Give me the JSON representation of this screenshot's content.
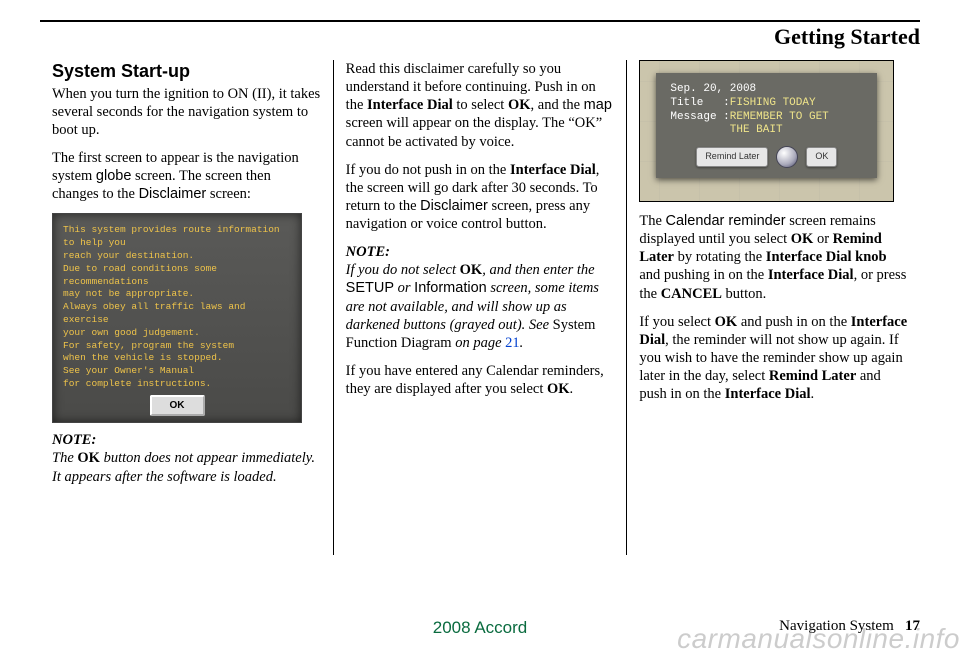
{
  "header": {
    "title": "Getting Started"
  },
  "col1": {
    "section_title": "System Start-up",
    "p1a": "When you turn the ignition to ON (II), it takes several seconds for the navigation system to boot up.",
    "p2_pre": "The first screen to appear is the navigation system ",
    "p2_globe": "globe",
    "p2_mid": " screen. The screen then changes to the ",
    "p2_disc": "Disclaimer",
    "p2_post": " screen:",
    "screen": {
      "l1": "This system provides route information to help you",
      "l2": "reach your destination.",
      "l3": "Due to road conditions some recommendations",
      "l4": "may not be appropriate.",
      "l5": "Always obey all traffic laws and exercise",
      "l6": "your own good judgement.",
      "l7": "For safety, program the system",
      "l8": "when the vehicle is stopped.",
      "l9": "See your Owner's Manual",
      "l10": "for complete instructions.",
      "ok": "OK"
    },
    "note_label": "NOTE:",
    "note_pre": "The ",
    "note_ok": "OK",
    "note_post": " button does not appear immediately. It appears after the software is loaded."
  },
  "col2": {
    "p1_pre": "Read this disclaimer carefully so you understand it before continuing. Push in on the ",
    "p1_id": "Interface Dial",
    "p1_mid1": " to select ",
    "p1_ok": "OK",
    "p1_mid2": ", and the ",
    "p1_map": "map",
    "p1_post": " screen will appear on the display. The “OK” cannot be activated by voice.",
    "p2_pre": "If you do not push in on the ",
    "p2_id": "Interface Dial",
    "p2_mid1": ", the screen will go dark after 30 seconds. To return to the ",
    "p2_disc": "Disclaimer",
    "p2_post": " screen, press any navigation or voice control button.",
    "note_label": "NOTE:",
    "n_pre": "If you do not select ",
    "n_ok": "OK",
    "n_mid1": ", and then enter the ",
    "n_setup": "SETUP",
    "n_or": " or ",
    "n_info": "Information",
    "n_mid2": " screen, some items are not available, and will show up as darkened buttons (grayed out). See ",
    "n_sfd": "System Function Diagram",
    "n_on": " on page ",
    "n_page": "21",
    "n_period": ".",
    "p3_pre": "If you have entered any Calendar reminders, they are displayed after you select ",
    "p3_ok": "OK",
    "p3_post": "."
  },
  "col3": {
    "popup": {
      "date": "Sep. 20, 2008",
      "title_label": "Title   :",
      "title_value": "FISHING TODAY",
      "msg_label": "Message :",
      "msg_value1": "REMEMBER TO GET",
      "msg_value2": "THE BAIT",
      "remind": "Remind Later",
      "ok": "OK"
    },
    "p1_pre": "The ",
    "p1_cal": "Calendar reminder",
    "p1_mid1": " screen remains displayed until you select ",
    "p1_ok": "OK",
    "p1_or": " or ",
    "p1_rl": "Remind Later",
    "p1_mid2": " by rotating the ",
    "p1_idk": "Interface Dial knob",
    "p1_mid3": " and pushing in on the ",
    "p1_id": "Interface Dial",
    "p1_mid4": ", or press the ",
    "p1_cancel": "CANCEL",
    "p1_post": " button.",
    "p2_pre": "If you select ",
    "p2_ok": "OK",
    "p2_mid1": " and push in on the ",
    "p2_id": "Interface Dial",
    "p2_mid2": ", the reminder will not show up again. If you wish to have the reminder show up again later in the day, select ",
    "p2_rl": "Remind Later",
    "p2_mid3": " and push in on the ",
    "p2_id2": "Interface Dial",
    "p2_post": "."
  },
  "footer": {
    "model": "2008   Accord",
    "section": "Navigation System",
    "page": "17"
  },
  "watermark": "carmanualsonline.info"
}
